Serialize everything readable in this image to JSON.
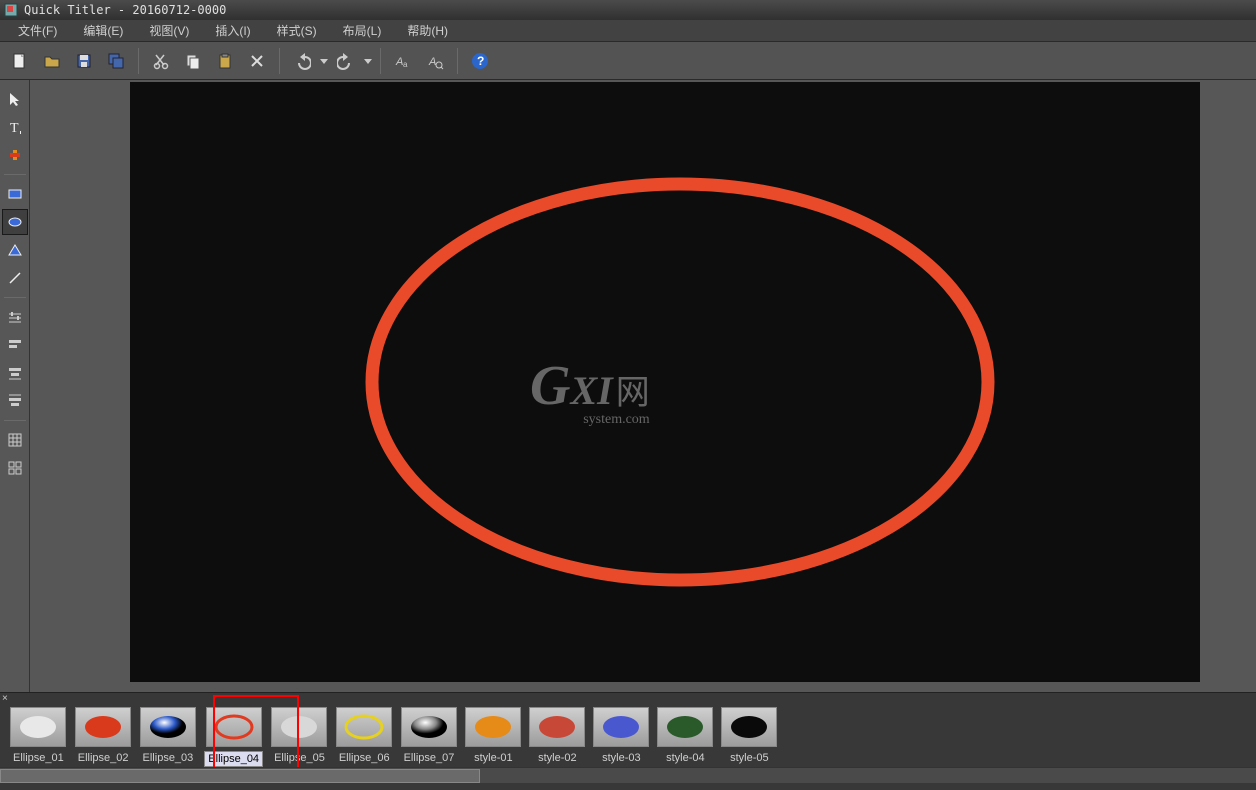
{
  "title": "Quick Titler - 20160712-0000",
  "menus": [
    "文件(F)",
    "编辑(E)",
    "视图(V)",
    "插入(I)",
    "样式(S)",
    "布局(L)",
    "帮助(H)"
  ],
  "canvas": {
    "watermark_g": "G",
    "watermark_xi": "XI",
    "watermark_wang": "网",
    "watermark_sys": "system.com"
  },
  "styles": [
    {
      "label": "Ellipse_01",
      "fill": "#e8e8e8",
      "stroke": "none",
      "kind": "solid"
    },
    {
      "label": "Ellipse_02",
      "fill": "#d93a1c",
      "stroke": "none",
      "kind": "solid"
    },
    {
      "label": "Ellipse_03",
      "fill": "#2a58c8",
      "stroke": "none",
      "kind": "glossy"
    },
    {
      "label": "Ellipse_04",
      "fill": "none",
      "stroke": "#e03a20",
      "kind": "outline",
      "selected": true
    },
    {
      "label": "Ellipse_05",
      "fill": "#d8d8d8",
      "stroke": "none",
      "kind": "solid"
    },
    {
      "label": "Ellipse_06",
      "fill": "none",
      "stroke": "#e6d020",
      "kind": "outline"
    },
    {
      "label": "Ellipse_07",
      "fill": "#888888",
      "stroke": "none",
      "kind": "glossy"
    },
    {
      "label": "style-01",
      "fill": "#e68a18",
      "stroke": "none",
      "kind": "solid"
    },
    {
      "label": "style-02",
      "fill": "#c84838",
      "stroke": "none",
      "kind": "solid"
    },
    {
      "label": "style-03",
      "fill": "#4a58d0",
      "stroke": "none",
      "kind": "solid"
    },
    {
      "label": "style-04",
      "fill": "#2a5a2a",
      "stroke": "none",
      "kind": "solid"
    },
    {
      "label": "style-05",
      "fill": "#0a0a0a",
      "stroke": "none",
      "kind": "solid"
    }
  ],
  "close_glyph": "×"
}
